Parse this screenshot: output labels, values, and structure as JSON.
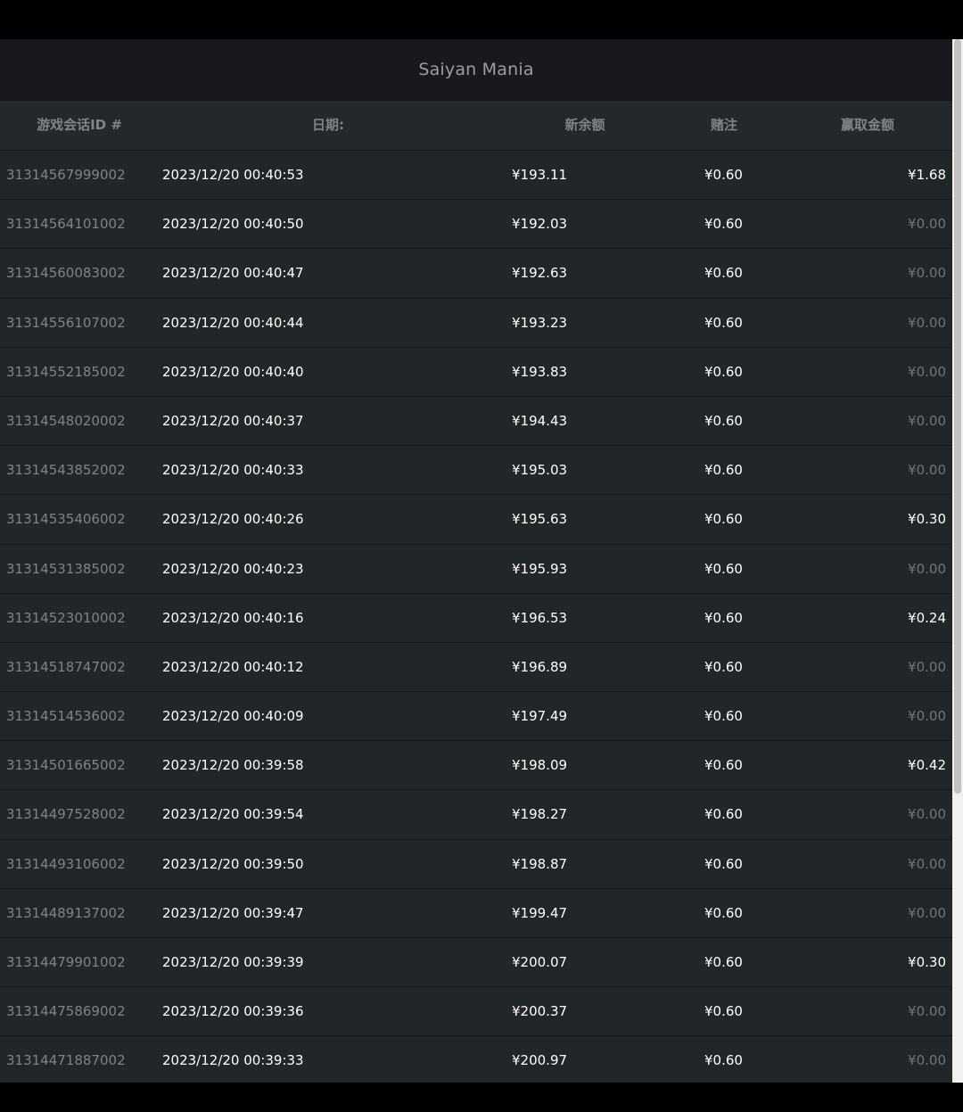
{
  "title": "Saiyan Mania",
  "headers": {
    "session_id": "游戏会话ID #",
    "date": "日期:",
    "new_balance": "新余额",
    "bet": "赌注",
    "win": "赢取金额"
  },
  "rows": [
    {
      "id": "31314567999002",
      "date": "2023/12/20 00:40:53",
      "balance": "¥193.11",
      "bet": "¥0.60",
      "win": "¥1.68"
    },
    {
      "id": "31314564101002",
      "date": "2023/12/20 00:40:50",
      "balance": "¥192.03",
      "bet": "¥0.60",
      "win": "¥0.00"
    },
    {
      "id": "31314560083002",
      "date": "2023/12/20 00:40:47",
      "balance": "¥192.63",
      "bet": "¥0.60",
      "win": "¥0.00"
    },
    {
      "id": "31314556107002",
      "date": "2023/12/20 00:40:44",
      "balance": "¥193.23",
      "bet": "¥0.60",
      "win": "¥0.00"
    },
    {
      "id": "31314552185002",
      "date": "2023/12/20 00:40:40",
      "balance": "¥193.83",
      "bet": "¥0.60",
      "win": "¥0.00"
    },
    {
      "id": "31314548020002",
      "date": "2023/12/20 00:40:37",
      "balance": "¥194.43",
      "bet": "¥0.60",
      "win": "¥0.00"
    },
    {
      "id": "31314543852002",
      "date": "2023/12/20 00:40:33",
      "balance": "¥195.03",
      "bet": "¥0.60",
      "win": "¥0.00"
    },
    {
      "id": "31314535406002",
      "date": "2023/12/20 00:40:26",
      "balance": "¥195.63",
      "bet": "¥0.60",
      "win": "¥0.30"
    },
    {
      "id": "31314531385002",
      "date": "2023/12/20 00:40:23",
      "balance": "¥195.93",
      "bet": "¥0.60",
      "win": "¥0.00"
    },
    {
      "id": "31314523010002",
      "date": "2023/12/20 00:40:16",
      "balance": "¥196.53",
      "bet": "¥0.60",
      "win": "¥0.24"
    },
    {
      "id": "31314518747002",
      "date": "2023/12/20 00:40:12",
      "balance": "¥196.89",
      "bet": "¥0.60",
      "win": "¥0.00"
    },
    {
      "id": "31314514536002",
      "date": "2023/12/20 00:40:09",
      "balance": "¥197.49",
      "bet": "¥0.60",
      "win": "¥0.00"
    },
    {
      "id": "31314501665002",
      "date": "2023/12/20 00:39:58",
      "balance": "¥198.09",
      "bet": "¥0.60",
      "win": "¥0.42"
    },
    {
      "id": "31314497528002",
      "date": "2023/12/20 00:39:54",
      "balance": "¥198.27",
      "bet": "¥0.60",
      "win": "¥0.00"
    },
    {
      "id": "31314493106002",
      "date": "2023/12/20 00:39:50",
      "balance": "¥198.87",
      "bet": "¥0.60",
      "win": "¥0.00"
    },
    {
      "id": "31314489137002",
      "date": "2023/12/20 00:39:47",
      "balance": "¥199.47",
      "bet": "¥0.60",
      "win": "¥0.00"
    },
    {
      "id": "31314479901002",
      "date": "2023/12/20 00:39:39",
      "balance": "¥200.07",
      "bet": "¥0.60",
      "win": "¥0.30"
    },
    {
      "id": "31314475869002",
      "date": "2023/12/20 00:39:36",
      "balance": "¥200.37",
      "bet": "¥0.60",
      "win": "¥0.00"
    },
    {
      "id": "31314471887002",
      "date": "2023/12/20 00:39:33",
      "balance": "¥200.97",
      "bet": "¥0.60",
      "win": "¥0.00"
    }
  ],
  "colors": {
    "background": "#212529",
    "title_bar": "#17191c",
    "text_primary": "#ffffff",
    "text_muted": "#7e8388"
  }
}
